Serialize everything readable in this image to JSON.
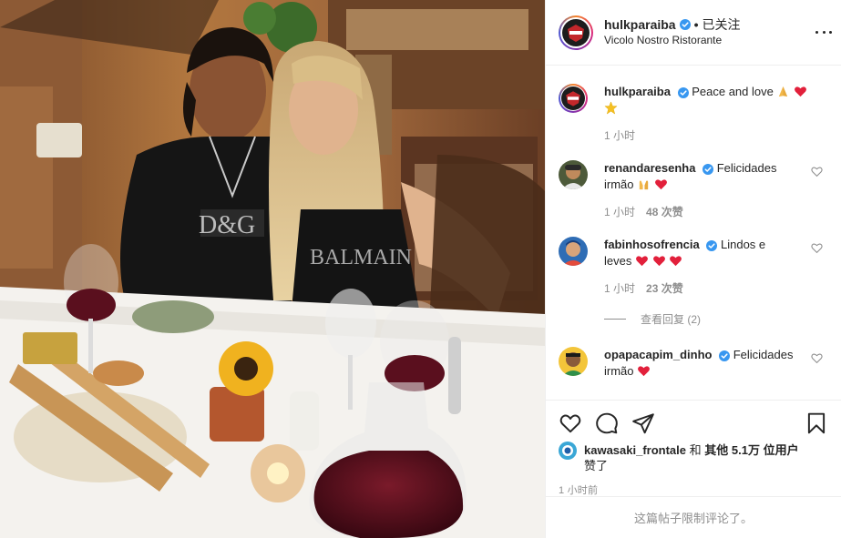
{
  "header": {
    "username": "hulkparaiba",
    "separator": "•",
    "follow_state": "已关注",
    "location": "Vicolo Nostro Ristorante"
  },
  "caption": {
    "username": "hulkparaiba",
    "text": "Peace and love",
    "time": "1 小时"
  },
  "comments": [
    {
      "username": "renandaresenha",
      "text_line1": "Felicidades",
      "text_line2": "irmão",
      "time": "1 小时",
      "likes": "48 次赞"
    },
    {
      "username": "fabinhosofrencia",
      "text_line1": "Lindos e",
      "text_line2": "leves",
      "time": "1 小时",
      "likes": "23 次赞"
    },
    {
      "username": "opapacapim_dinho",
      "text_line1": "Felicidades",
      "text_line2": "irmão"
    }
  ],
  "view_replies": "查看回复 (2)",
  "likes": {
    "user": "kawasaki_frontale",
    "connector": "和",
    "others": "其他 5.1万 位用户",
    "suffix": "赞了"
  },
  "timestamp": "1 小时前",
  "comments_limited": "这篇帖子限制评论了。",
  "icons": {
    "verified": "verified-badge-icon",
    "more": "more-options-icon",
    "like": "heart-outline-icon",
    "comment": "comment-bubble-icon",
    "share": "paper-plane-icon",
    "save": "bookmark-icon"
  },
  "colors": {
    "verified": "#3897f0",
    "heart": "#ed4956",
    "muted": "#8e8e8e",
    "text": "#262626"
  }
}
